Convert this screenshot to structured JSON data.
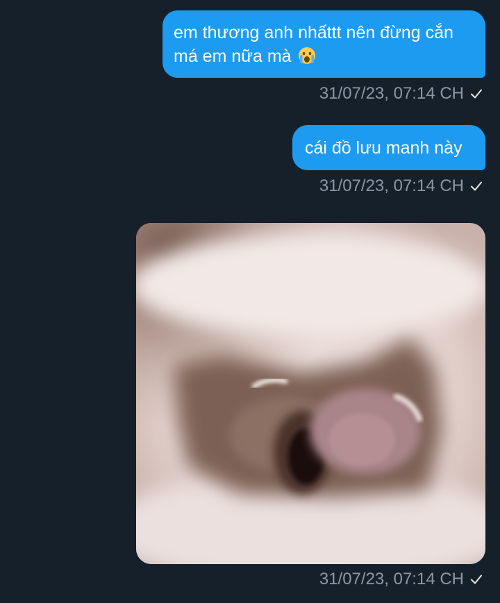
{
  "messages": [
    {
      "text_line1": "em thương anh nhấttt nên đừng cắn",
      "text_line2": "má em nữa mà",
      "emoji": "crying-face-emoji",
      "timestamp": "31/07/23, 07:14 CH"
    },
    {
      "text": "cái đồ lưu manh này",
      "timestamp": "31/07/23, 07:14 CH"
    },
    {
      "image": "blurry-crying-face-photo",
      "timestamp": "31/07/23, 07:14 CH"
    }
  ],
  "colors": {
    "background": "#16202b",
    "bubble": "#1d9bf0",
    "bubble_text": "#ffffff",
    "meta_text": "#8b98a5"
  },
  "icons": {
    "sent": "checkmark-icon"
  }
}
